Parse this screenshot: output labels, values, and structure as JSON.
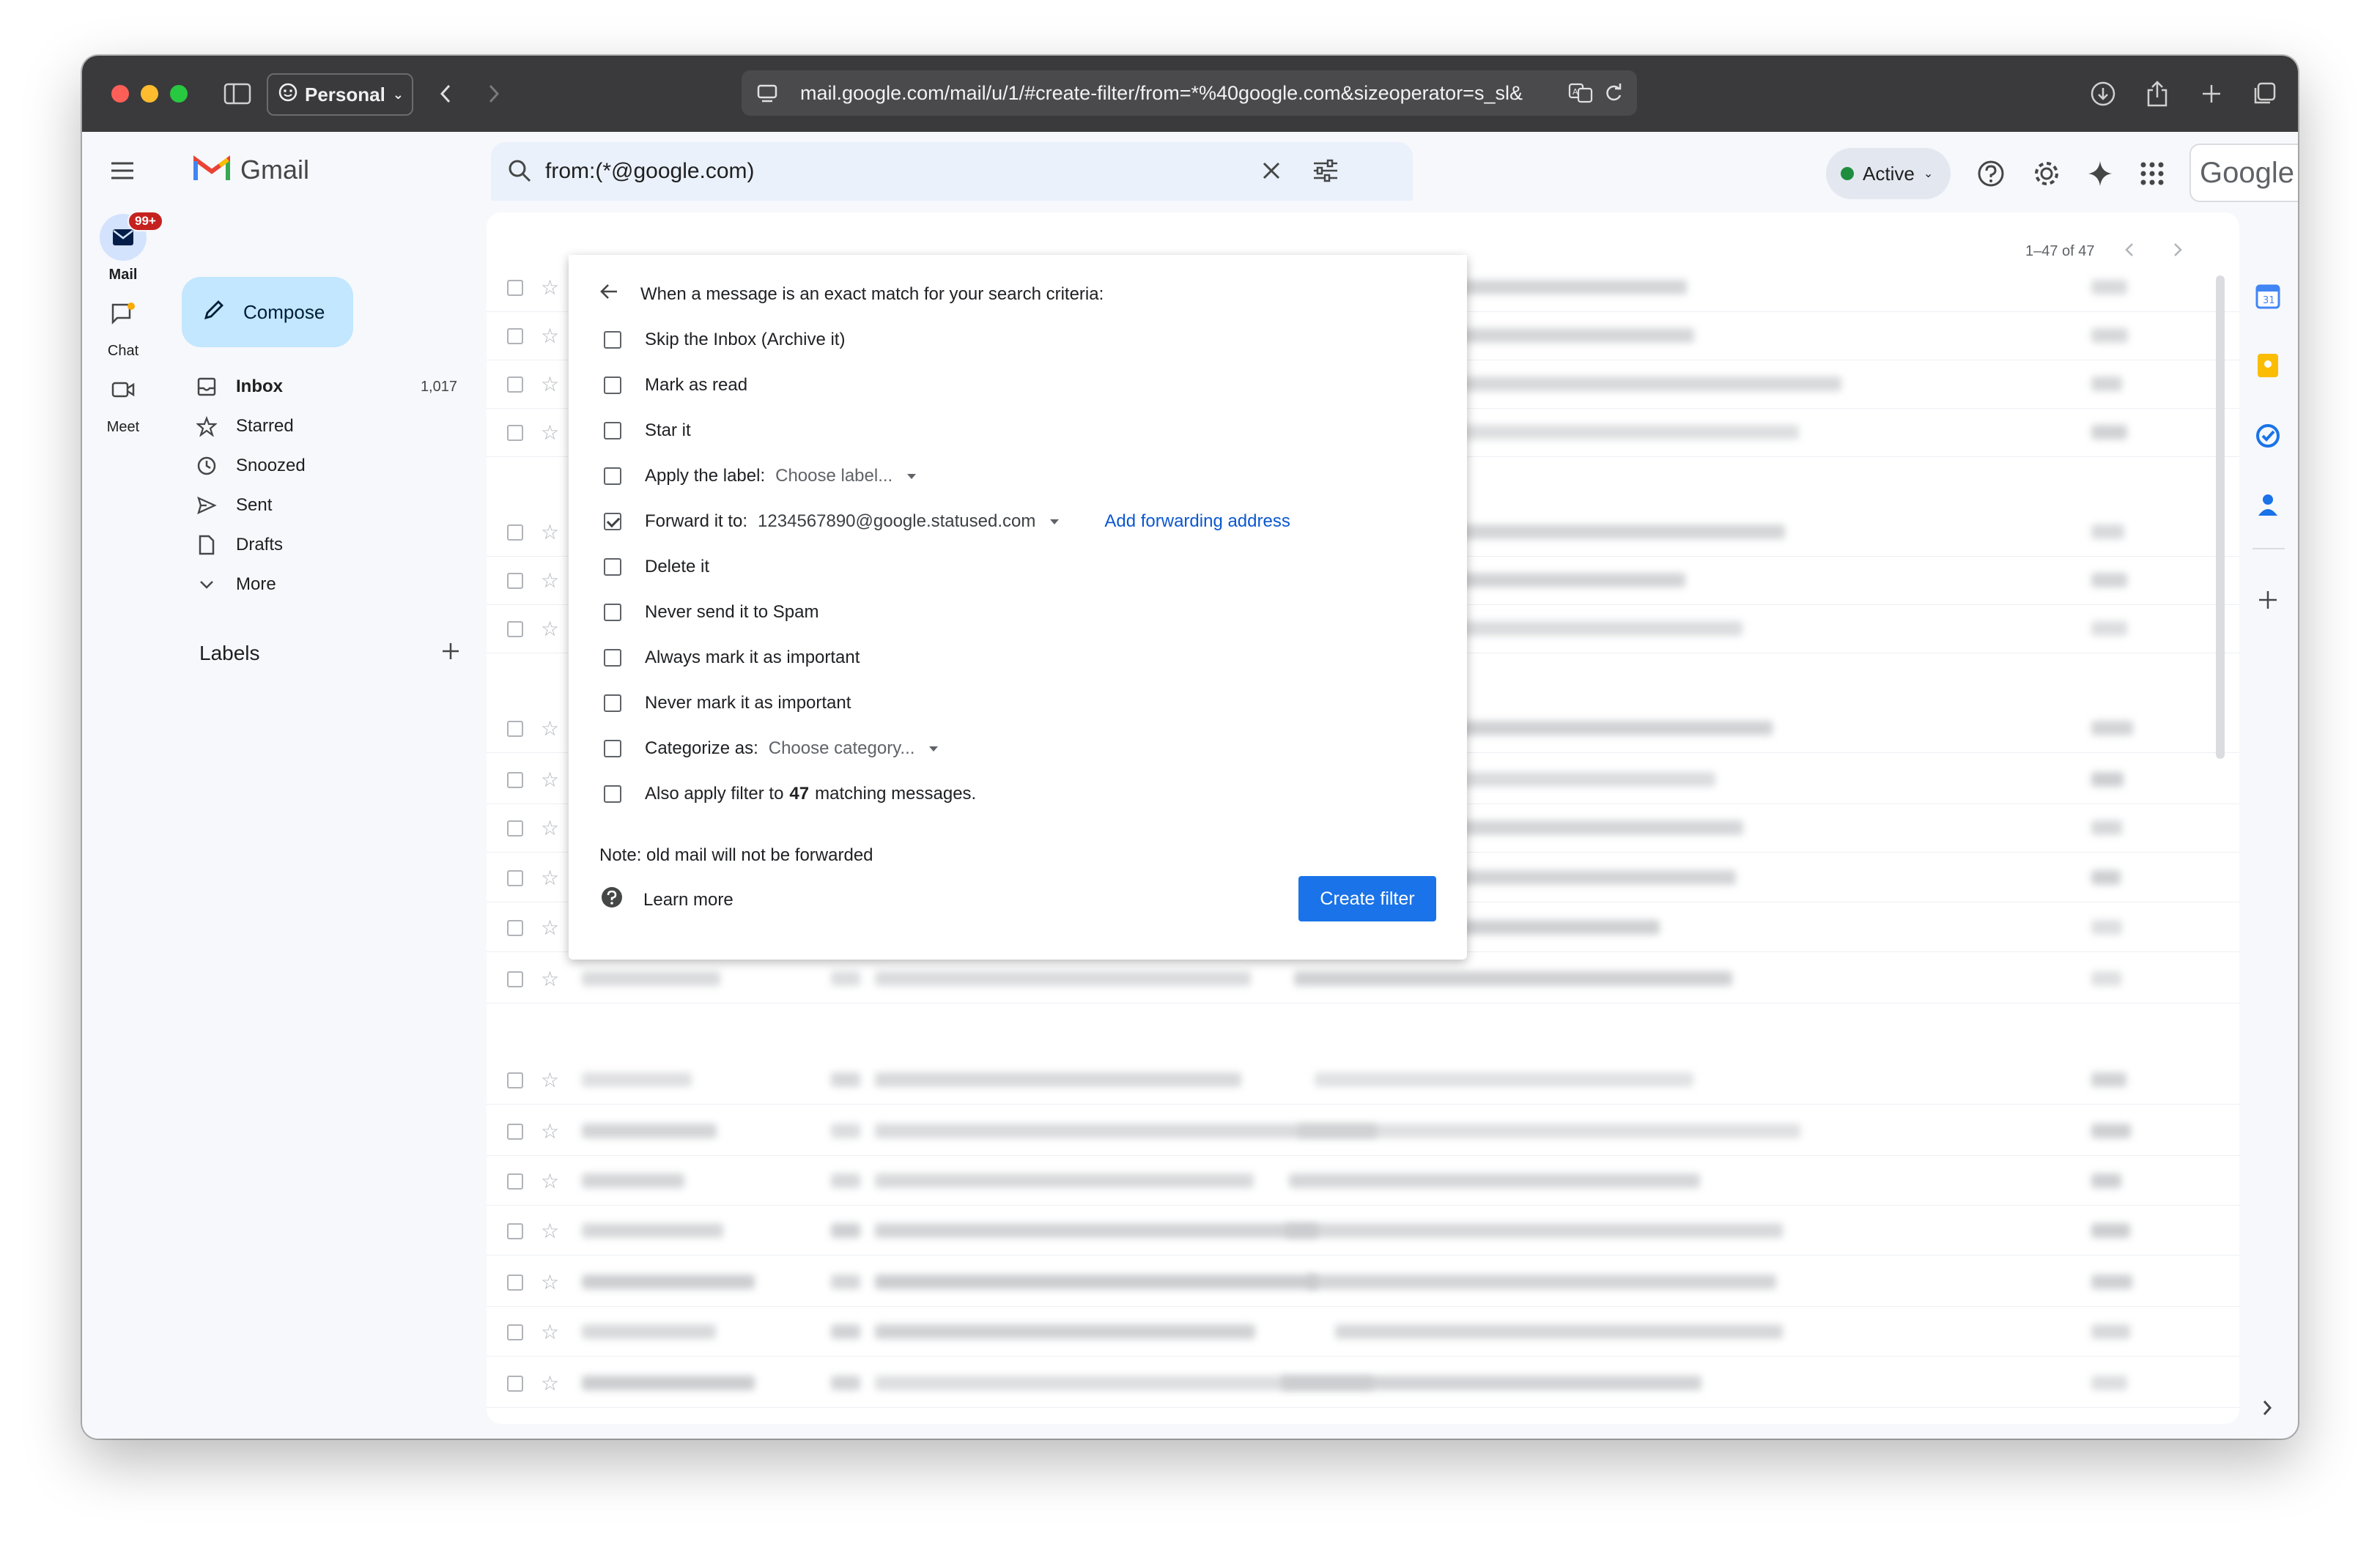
{
  "browser": {
    "profile": "Personal",
    "url": "mail.google.com/mail/u/1/#create-filter/from=*%40google.com&sizeoperator=s_sl&"
  },
  "app": {
    "name": "Gmail",
    "brand": "Google"
  },
  "rail": {
    "mail_label": "Mail",
    "mail_badge": "99+",
    "chat_label": "Chat",
    "meet_label": "Meet"
  },
  "search": {
    "query": "from:(*@google.com)"
  },
  "status": {
    "label": "Active",
    "color": "#1e8e3e"
  },
  "sidebar": {
    "compose": "Compose",
    "items": [
      {
        "label": "Inbox",
        "count": "1,017",
        "icon": "inbox-icon"
      },
      {
        "label": "Starred",
        "icon": "star-icon"
      },
      {
        "label": "Snoozed",
        "icon": "clock-icon"
      },
      {
        "label": "Sent",
        "icon": "send-icon"
      },
      {
        "label": "Drafts",
        "icon": "draft-icon"
      },
      {
        "label": "More",
        "icon": "chevron-down-icon"
      }
    ],
    "labels_heading": "Labels"
  },
  "pagination": {
    "range": "1–47 of 47"
  },
  "filter": {
    "heading": "When a message is an exact match for your search criteria:",
    "options": {
      "skip_inbox": "Skip the Inbox (Archive it)",
      "mark_read": "Mark as read",
      "star": "Star it",
      "apply_label": "Apply the label:",
      "apply_label_select": "Choose label...",
      "forward": "Forward it to:",
      "forward_address": "1234567890@google.statused.com",
      "add_forwarding": "Add forwarding address",
      "delete": "Delete it",
      "never_spam": "Never send it to Spam",
      "always_important": "Always mark it as important",
      "never_important": "Never mark it as important",
      "categorize": "Categorize as:",
      "categorize_select": "Choose category...",
      "also_apply_prefix": "Also apply filter to",
      "also_apply_count": "47",
      "also_apply_suffix": "matching messages."
    },
    "forward_checked": true,
    "note": "Note: old mail will not be forwarded",
    "learn_more": "Learn more",
    "create_button": "Create filter"
  },
  "colors": {
    "accent": "#1a73e8",
    "compose_bg": "#c2e7ff",
    "badge": "#c5221f"
  }
}
